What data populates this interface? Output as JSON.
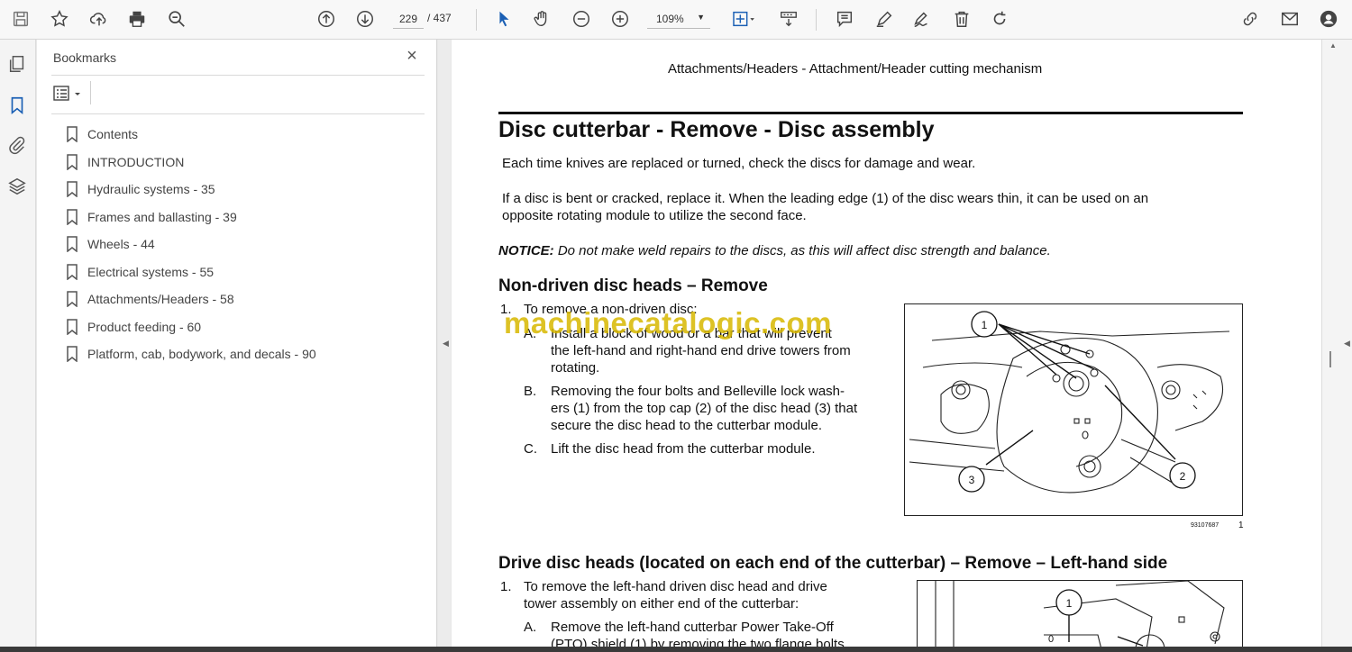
{
  "toolbar": {
    "page_current": "229",
    "page_total": "/ 437",
    "zoom": "109%"
  },
  "icons": [
    "save-icon",
    "star-icon",
    "upload-icon",
    "print-icon",
    "search-icon",
    "page-up-icon",
    "page-down-icon",
    "select-arrow-icon",
    "hand-icon",
    "zoom-out-icon",
    "zoom-in-icon",
    "fit-page-icon",
    "scroll-mode-icon",
    "comment-icon",
    "pen-icon",
    "sign-icon",
    "trash-icon",
    "undo-icon",
    "share-link-icon",
    "mail-icon",
    "account-icon"
  ],
  "panel": {
    "title": "Bookmarks",
    "close": "×",
    "bookmarks": [
      "Contents",
      "INTRODUCTION",
      "Hydraulic systems - 35",
      "Frames and ballasting - 39",
      "Wheels - 44",
      "Electrical systems - 55",
      "Attachments/Headers - 58",
      "Product feeding - 60",
      "Platform, cab, bodywork, and decals - 90"
    ]
  },
  "document": {
    "running_head": "Attachments/Headers - Attachment/Header cutting mechanism",
    "title": "Disc cutterbar - Remove - Disc assembly",
    "para1": "Each time knives are replaced or turned, check the discs for damage and wear.",
    "para2_line1": "If a disc is bent or cracked, replace it. When the leading edge (1) of the disc wears thin, it can be used on an",
    "para2_line2": "opposite rotating module to utilize the second face.",
    "notice_label": "NOTICE:",
    "notice_text": " Do not make weld repairs to the discs, as this will affect disc strength and balance.",
    "section1": "Non-driven disc heads – Remove",
    "s1_step1": "To remove a non-driven disc:",
    "s1_num1": "1.",
    "s1_a_label": "A.",
    "s1_a_line1": "Install a block of wood or a bar that will prevent",
    "s1_a_line2": "the left-hand and right-hand end drive towers from",
    "s1_a_line3": "rotating.",
    "s1_b_label": "B.",
    "s1_b_line1": "Removing the four bolts and Belleville lock wash-",
    "s1_b_line2": "ers (1) from the top cap (2) of the disc head (3) that",
    "s1_b_line3": "secure the disc head to the cutterbar module.",
    "s1_c_label": "C.",
    "s1_c_line1": "Lift the disc head from the cutterbar module.",
    "fig1_id": "93107687",
    "fig1_num": "1",
    "fig1_callouts": [
      "1",
      "2",
      "3"
    ],
    "section2": "Drive disc heads (located on each end of the cutterbar) – Remove – Left-hand side",
    "s2_num1": "1.",
    "s2_step1_line1": "To remove the left-hand driven disc head and drive",
    "s2_step1_line2": "tower assembly on either end of the cutterbar:",
    "s2_a_label": "A.",
    "s2_a_line1": "Remove the left-hand cutterbar Power Take-Off",
    "s2_a_line2": "(PTO) shield (1) by removing the two flange bolts",
    "fig2_callouts": [
      "1",
      "0"
    ],
    "watermark": "machinecatalogic.com"
  }
}
